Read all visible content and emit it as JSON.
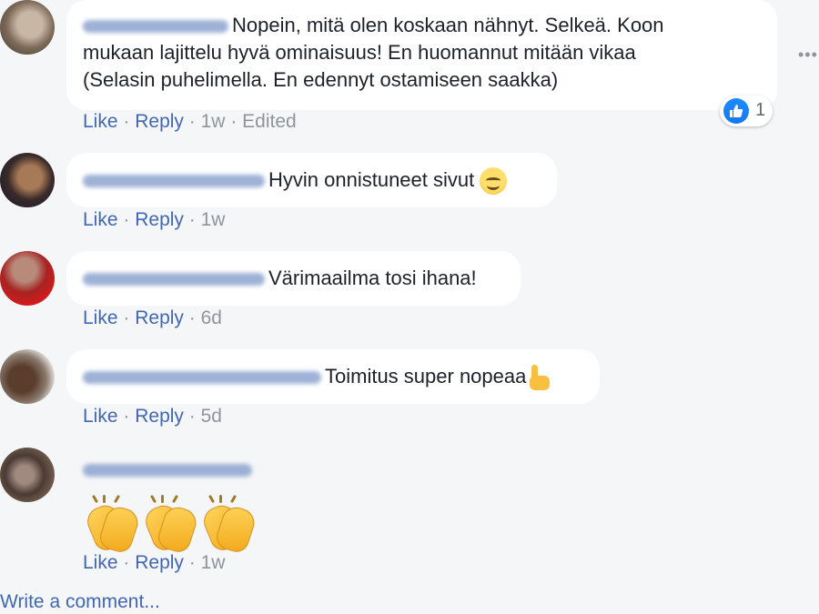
{
  "comments": [
    {
      "avatar": "user-avatar",
      "text": "Nopein, mitä olen koskaan nähnyt. Selkeä. Koon mukaan lajittelu hyvä ominaisuus! En huomannut mitään vikaa (Selasin puhelimella. En edennyt ostamiseen saakka)",
      "text_lines": [
        "Nopein, mitä olen koskaan nähnyt. Selkeä. Koon",
        "mukaan lajittelu hyvä ominaisuus! En huomannut mitään vikaa",
        "(Selasin puhelimella. En edennyt ostamiseen saakka)"
      ],
      "like": "Like",
      "reply": "Reply",
      "time": "1w",
      "edited": "Edited",
      "reactions": {
        "icon": "thumbs-up-icon",
        "count": "1"
      }
    },
    {
      "avatar": "user-avatar",
      "text": "Hyvin onnistuneet sivut",
      "emoji": "smiling-face-icon",
      "like": "Like",
      "reply": "Reply",
      "time": "1w"
    },
    {
      "avatar": "user-avatar",
      "text": "Värimaailma tosi ihana!",
      "like": "Like",
      "reply": "Reply",
      "time": "6d"
    },
    {
      "avatar": "user-avatar",
      "text": "Toimitus super nopeaa",
      "emoji": "pointing-hand-icon",
      "like": "Like",
      "reply": "Reply",
      "time": "5d"
    },
    {
      "avatar": "user-avatar",
      "emojis": [
        "clapping-hands-icon",
        "clapping-hands-icon",
        "clapping-hands-icon"
      ],
      "like": "Like",
      "reply": "Reply",
      "time": "1w"
    }
  ],
  "separator": "·",
  "more_icon": "ellipsis-icon",
  "write_comment": "Write a comment...",
  "colors": {
    "link": "#4267b2",
    "meta": "#90949c",
    "bubble": "#ffffff",
    "background": "#f5f6f7",
    "like": "#1877f2"
  }
}
